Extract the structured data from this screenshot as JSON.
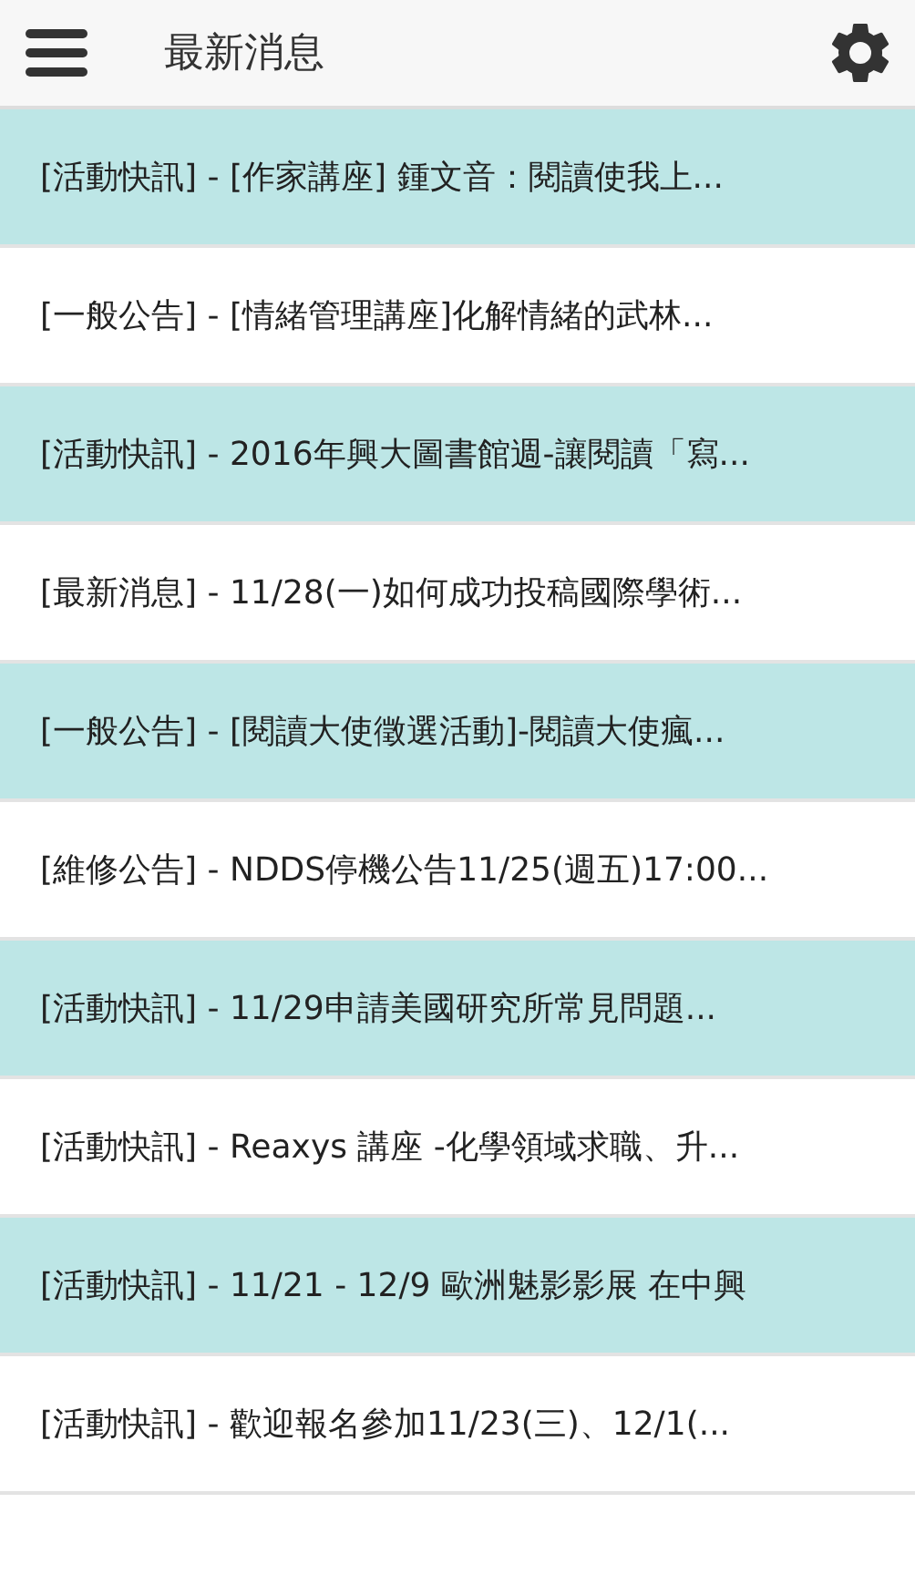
{
  "app_bar": {
    "title": "最新消息"
  },
  "news": [
    {
      "text": "[活動快訊] - [作家講座] 鍾文音：閱讀使我上..."
    },
    {
      "text": "[一般公告] - [情緒管理講座]化解情緒的武林..."
    },
    {
      "text": "[活動快訊] - 2016年興大圖書館週-讓閱讀「寫..."
    },
    {
      "text": "[最新消息] - 11/28(一)如何成功投稿國際學術..."
    },
    {
      "text": "[一般公告] - [閱讀大使徵選活動]-閱讀大使瘋..."
    },
    {
      "text": "[維修公告] - NDDS停機公告11/25(週五)17:00..."
    },
    {
      "text": "[活動快訊] - 11/29申請美國研究所常見問題..."
    },
    {
      "text": "[活動快訊] - Reaxys 講座 -化學領域求職、升..."
    },
    {
      "text": "[活動快訊] - 11/21 - 12/9 歐洲魅影影展 在中興"
    },
    {
      "text": "[活動快訊] - 歡迎報名參加11/23(三)、12/1(..."
    }
  ]
}
